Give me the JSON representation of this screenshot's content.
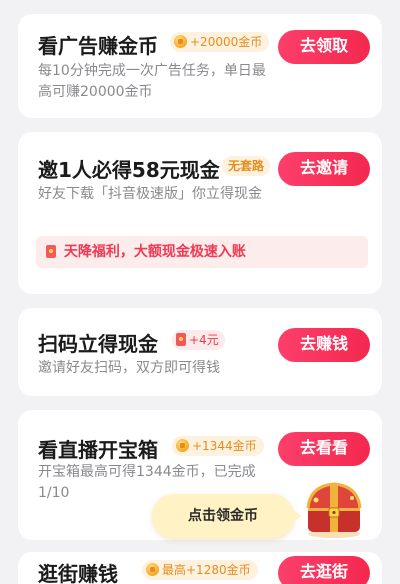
{
  "tasks": [
    {
      "title": "看广告赚金币",
      "badge": "+20000金币",
      "description": "每10分钟完成一次广告任务，单日最高可赚20000金币",
      "button": "去领取"
    },
    {
      "title": "邀1人必得58元现金",
      "badge": "无套路",
      "description": "好友下载「抖音极速版」你立得现金",
      "promo": "天降福利，大额现金极速入账",
      "button": "去邀请"
    },
    {
      "title": "扫码立得现金",
      "badge": "+4元",
      "description": "邀请好友扫码，双方即可得钱",
      "button": "去赚钱"
    },
    {
      "title": "看直播开宝箱",
      "badge": "+1344金币",
      "description": "开宝箱最高可得1344金币，已完成1/10",
      "button": "去看看"
    },
    {
      "title": "逛街赚钱",
      "badge": "最高+1280金币",
      "button": "去逛街"
    }
  ],
  "popup": {
    "label": "点击领金币"
  },
  "icons": {
    "coin": "coin-icon",
    "red_packet": "red-packet-icon",
    "chest": "treasure-chest-icon"
  },
  "colors": {
    "accent": "#f4284f",
    "badge_text": "#e78d1d",
    "promo_bg": "#fdecec"
  }
}
